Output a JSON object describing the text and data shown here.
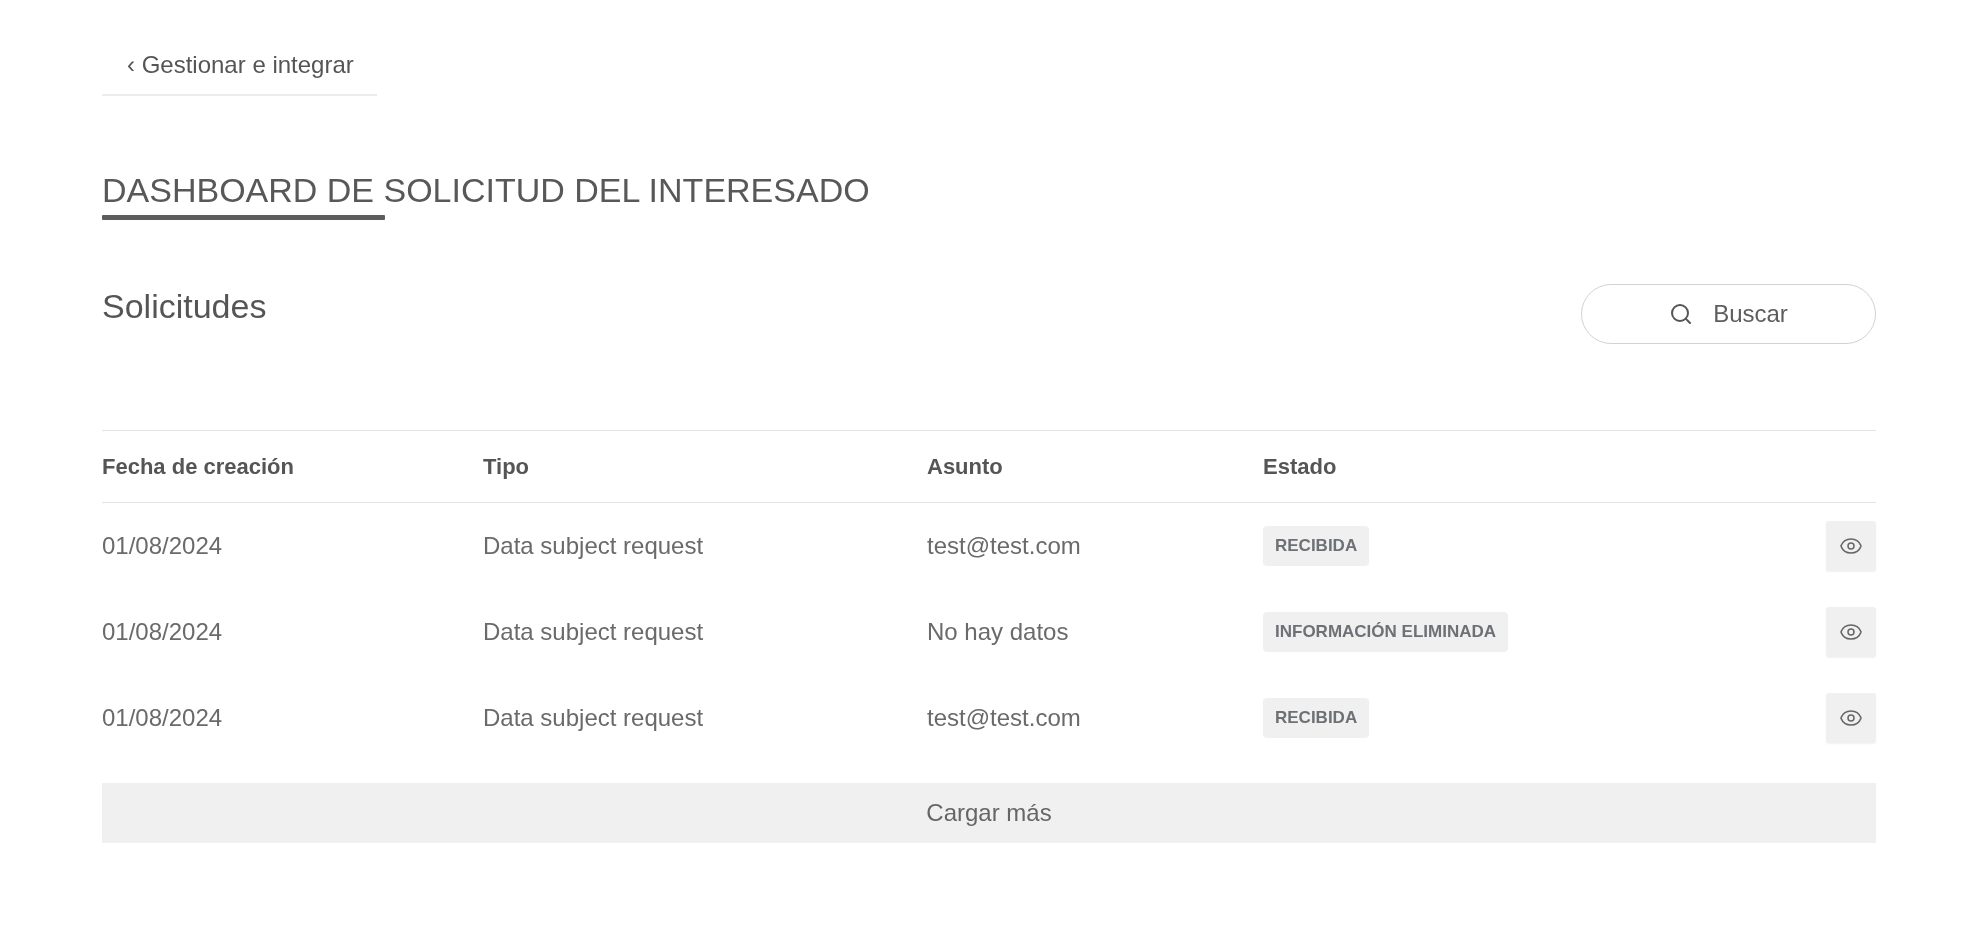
{
  "back_link": {
    "label": "‹ Gestionar e integrar"
  },
  "page_title": {
    "text": "DASHBOARD DE SOLICITUD DEL INTERESADO"
  },
  "section": {
    "title": "Solicitudes",
    "search_button": {
      "label": "Buscar"
    }
  },
  "table": {
    "columns": [
      "Fecha de creación",
      "Tipo",
      "Asunto",
      "Estado"
    ],
    "rows": [
      {
        "created": "01/08/2024",
        "type": "Data subject request",
        "subject": "test@test.com",
        "status": "RECIBIDA"
      },
      {
        "created": "01/08/2024",
        "type": "Data subject request",
        "subject": "No hay datos",
        "status": "INFORMACIÓN ELIMINADA"
      },
      {
        "created": "01/08/2024",
        "type": "Data subject request",
        "subject": "test@test.com",
        "status": "RECIBIDA"
      }
    ]
  },
  "load_more": {
    "label": "Cargar más"
  }
}
